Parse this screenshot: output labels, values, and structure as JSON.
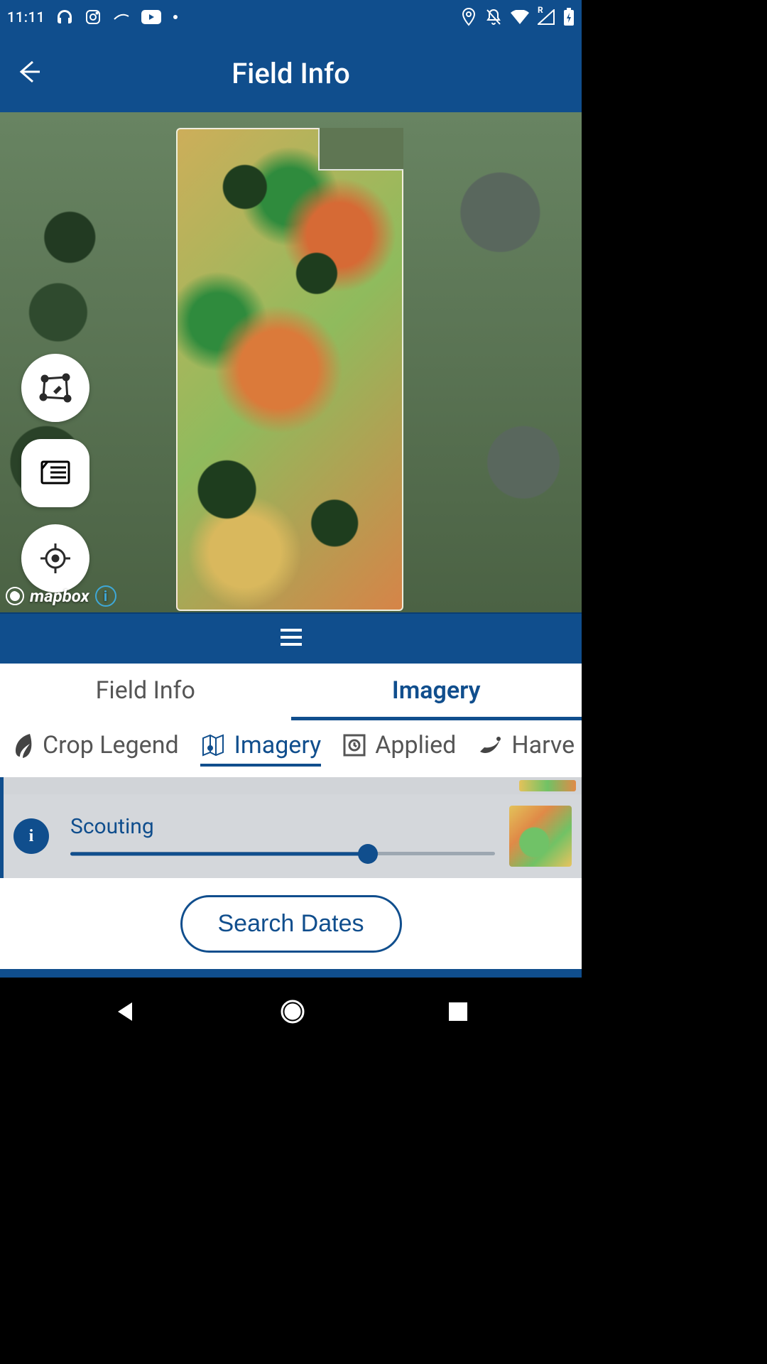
{
  "status": {
    "time": "11:11",
    "signal_badge": "R"
  },
  "header": {
    "title": "Field Info"
  },
  "map": {
    "attribution": "mapbox"
  },
  "main_tabs": [
    {
      "label": "Field Info",
      "active": false
    },
    {
      "label": "Imagery",
      "active": true
    }
  ],
  "sub_tabs": [
    {
      "label": "Crop Legend",
      "icon": "leaf-icon",
      "active": false
    },
    {
      "label": "Imagery",
      "icon": "map-imagery-icon",
      "active": true
    },
    {
      "label": "Applied",
      "icon": "applied-box-icon",
      "active": false
    },
    {
      "label": "Harve",
      "icon": "sickle-icon",
      "active": false
    }
  ],
  "imagery": {
    "current": {
      "title": "Scouting",
      "slider_percent": 70
    }
  },
  "buttons": {
    "search_dates": "Search Dates"
  }
}
